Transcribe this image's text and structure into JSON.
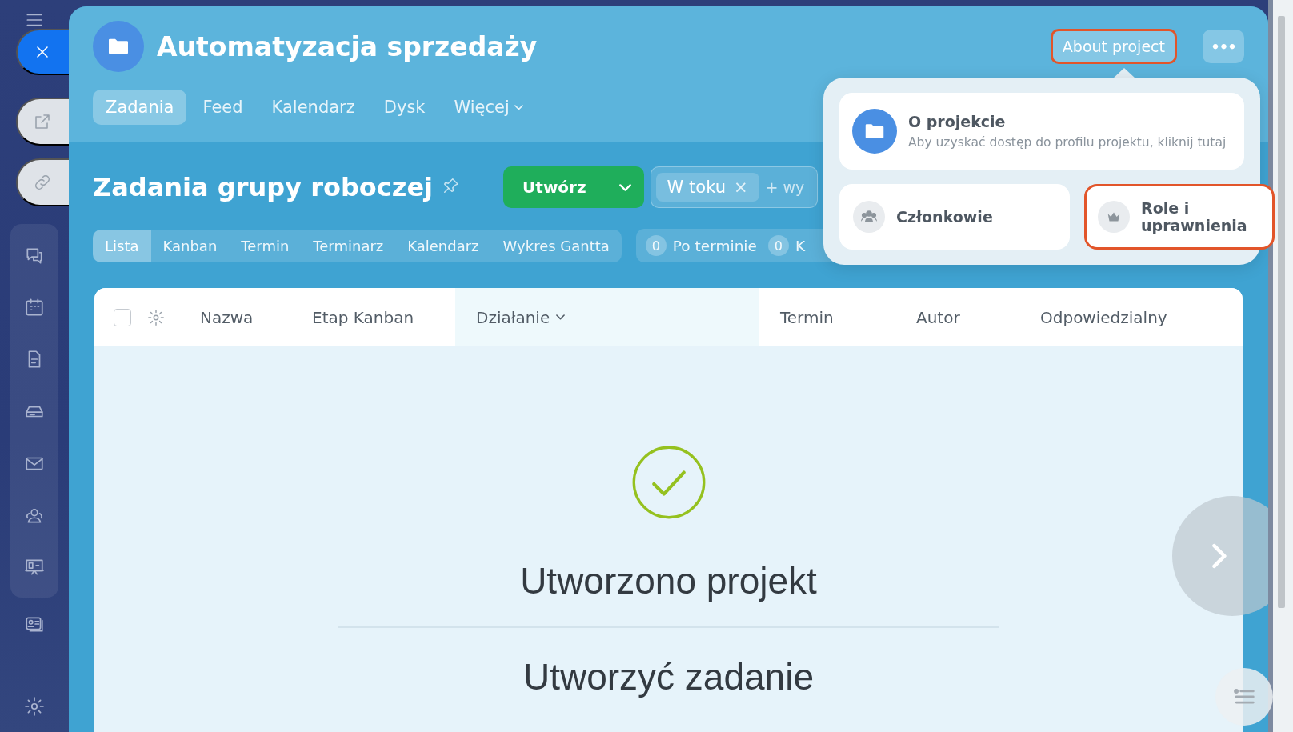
{
  "project": {
    "title": "Automatyzacja sprzedaży"
  },
  "header_buttons": {
    "about": {
      "label": "About project",
      "highlighted": true
    },
    "more": {
      "label": "•••"
    }
  },
  "tabs": [
    {
      "label": "Zadania",
      "selected": true
    },
    {
      "label": "Feed",
      "selected": false
    },
    {
      "label": "Kalendarz",
      "selected": false
    },
    {
      "label": "Dysk",
      "selected": false
    },
    {
      "label": "Więcej",
      "selected": false,
      "dropdown": true
    }
  ],
  "page_title": "Zadania grupy roboczej",
  "create_button": {
    "label": "Utwórz"
  },
  "filter": {
    "chips": [
      {
        "label": "W toku",
        "remove": "×"
      }
    ],
    "placeholder": "+ wy"
  },
  "views": [
    {
      "label": "Lista",
      "selected": true
    },
    {
      "label": "Kanban",
      "selected": false
    },
    {
      "label": "Termin",
      "selected": false
    },
    {
      "label": "Terminarz",
      "selected": false
    },
    {
      "label": "Kalendarz",
      "selected": false
    },
    {
      "label": "Wykres Gantta",
      "selected": false
    }
  ],
  "counters": [
    {
      "count": "0",
      "label": "Po terminie"
    },
    {
      "count": "0",
      "label": "K"
    }
  ],
  "table": {
    "select_all_checked": false,
    "columns": [
      {
        "label": "Nazwa",
        "highlighted": false,
        "sortable": false
      },
      {
        "label": "Etap Kanban",
        "highlighted": false,
        "sortable": false
      },
      {
        "label": "Działanie",
        "highlighted": true,
        "sortable": true
      },
      {
        "label": "Termin",
        "highlighted": false,
        "sortable": false
      },
      {
        "label": "Autor",
        "highlighted": false,
        "sortable": false
      },
      {
        "label": "Odpowiedzialny",
        "highlighted": false,
        "sortable": false
      }
    ]
  },
  "empty_state": {
    "title": "Utworzono projekt",
    "subtitle": "Utworzyć zadanie"
  },
  "popup": {
    "main": {
      "title": "O projekcie",
      "description": "Aby uzyskać dostęp do profilu projektu, kliknij tutaj"
    },
    "options": [
      {
        "kind": "members",
        "label": "Członkowie",
        "highlighted": false
      },
      {
        "kind": "roles",
        "label": "Role i uprawnienia",
        "highlighted": true
      }
    ]
  }
}
